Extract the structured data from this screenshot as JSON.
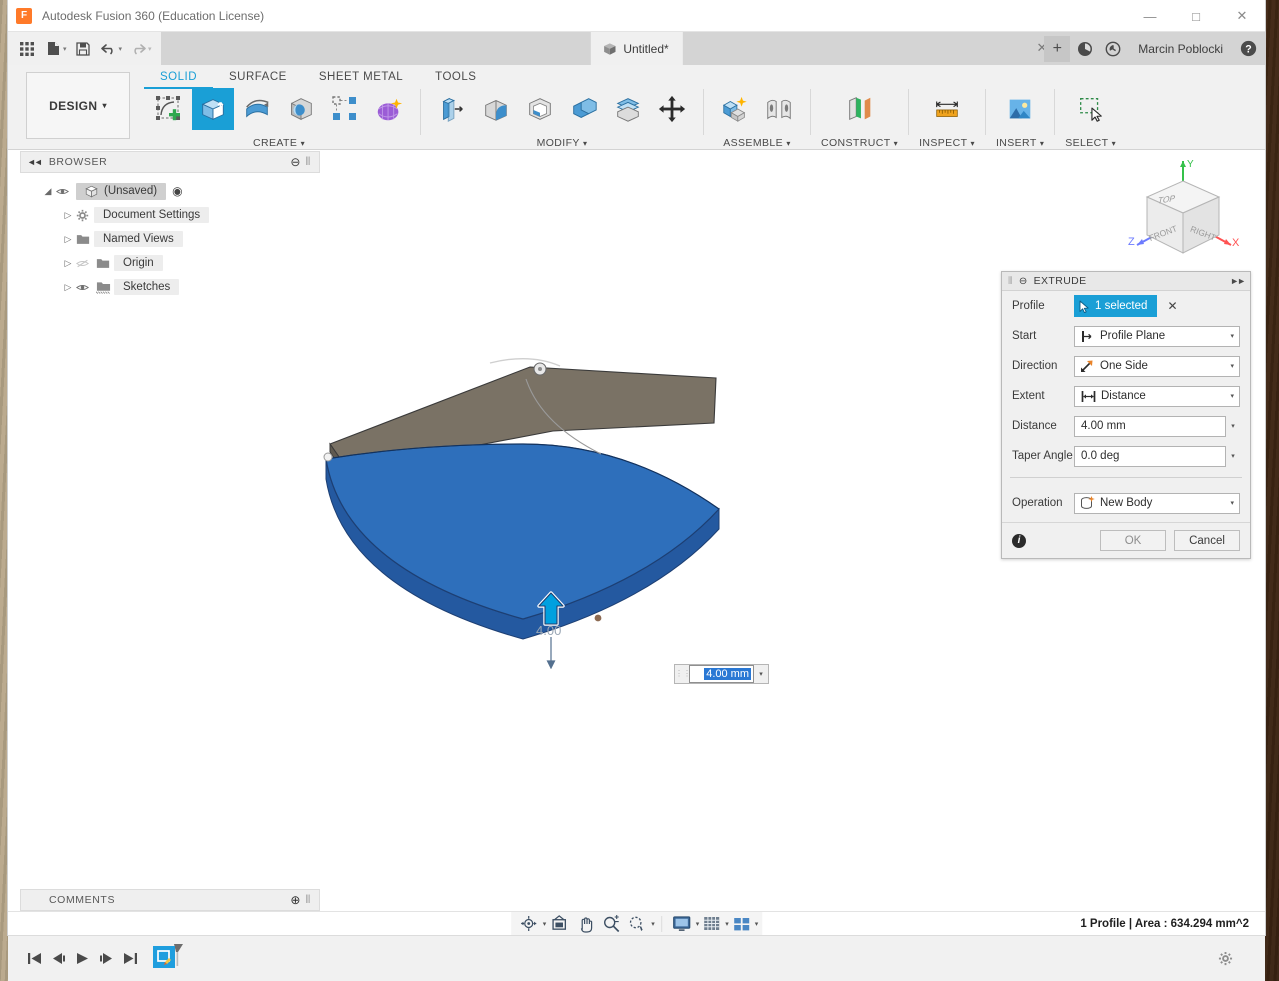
{
  "window": {
    "title": "Autodesk Fusion 360 (Education License)",
    "logo_letter": "F",
    "minimize": "—",
    "maximize": "□",
    "close": "✕"
  },
  "quick_access": {
    "grid_icon": "app-grid-icon",
    "new_icon": "new-document-icon",
    "save_icon": "save-icon",
    "undo_icon": "undo-icon",
    "redo_icon": "redo-icon",
    "caret": "▾"
  },
  "document_tab": {
    "label": "Untitled*",
    "close": "✕",
    "new_tab": "+"
  },
  "account": {
    "username": "Marcin Poblocki",
    "job_status_icon": "job-status-icon",
    "recent_icon": "recent-clock-icon",
    "help_icon": "help-icon"
  },
  "ribbon": {
    "workspace": "DESIGN",
    "workspace_caret": "▾",
    "tabs": [
      {
        "label": "SOLID",
        "active": true
      },
      {
        "label": "SURFACE",
        "active": false
      },
      {
        "label": "SHEET METAL",
        "active": false
      },
      {
        "label": "TOOLS",
        "active": false
      }
    ],
    "groups": [
      {
        "label": "CREATE",
        "caret": "▾",
        "buttons": [
          {
            "name": "create-sketch-button",
            "icon": "create-sketch-icon",
            "selected": false
          },
          {
            "name": "extrude-button",
            "icon": "extrude-icon",
            "selected": true
          },
          {
            "name": "revolve-button",
            "icon": "revolve-icon",
            "selected": false
          },
          {
            "name": "sphere-button",
            "icon": "sphere-primitive-icon",
            "selected": false
          },
          {
            "name": "pattern-button",
            "icon": "rectangular-pattern-icon",
            "selected": false
          },
          {
            "name": "create-form-button",
            "icon": "create-form-icon",
            "selected": false
          }
        ]
      },
      {
        "label": "MODIFY",
        "caret": "▾",
        "buttons": [
          {
            "name": "press-pull-button",
            "icon": "press-pull-icon",
            "selected": false
          },
          {
            "name": "fillet-button",
            "icon": "fillet-icon",
            "selected": false
          },
          {
            "name": "shell-button",
            "icon": "shell-icon",
            "selected": false
          },
          {
            "name": "combine-button",
            "icon": "combine-icon",
            "selected": false
          },
          {
            "name": "split-face-button",
            "icon": "split-face-icon",
            "selected": false
          },
          {
            "name": "move-copy-button",
            "icon": "move-copy-icon",
            "selected": false
          }
        ]
      },
      {
        "label": "ASSEMBLE",
        "caret": "▾",
        "buttons": [
          {
            "name": "new-component-button",
            "icon": "new-component-icon",
            "selected": false
          },
          {
            "name": "joint-button",
            "icon": "joint-icon",
            "selected": false
          }
        ]
      },
      {
        "label": "CONSTRUCT",
        "caret": "▾",
        "buttons": [
          {
            "name": "offset-plane-button",
            "icon": "offset-plane-icon",
            "selected": false
          }
        ]
      },
      {
        "label": "INSPECT",
        "caret": "▾",
        "buttons": [
          {
            "name": "measure-button",
            "icon": "measure-ruler-icon",
            "selected": false
          }
        ]
      },
      {
        "label": "INSERT",
        "caret": "▾",
        "buttons": [
          {
            "name": "insert-image-button",
            "icon": "insert-image-icon",
            "selected": false
          }
        ]
      },
      {
        "label": "SELECT",
        "caret": "▾",
        "buttons": [
          {
            "name": "select-tool-button",
            "icon": "select-window-cursor-icon",
            "selected": false
          }
        ]
      }
    ]
  },
  "browser": {
    "title": "BROWSER",
    "collapse_icon": "collapse-left-icon",
    "minus_icon": "minimize-panel-icon",
    "grip_icon": "panel-grip-icon",
    "tree": [
      {
        "label": "(Unsaved)",
        "caret": "◢",
        "eye": "visible",
        "icon": "component-cube-icon",
        "indent": 0,
        "root": true
      },
      {
        "label": "Document Settings",
        "caret": "▷",
        "eye": "none",
        "icon": "gear-icon",
        "indent": 1,
        "root": false
      },
      {
        "label": "Named Views",
        "caret": "▷",
        "eye": "none",
        "icon": "folder-icon",
        "indent": 1,
        "root": false
      },
      {
        "label": "Origin",
        "caret": "▷",
        "eye": "hidden",
        "icon": "folder-icon",
        "indent": 1,
        "root": false
      },
      {
        "label": "Sketches",
        "caret": "▷",
        "eye": "visible",
        "icon": "folder-icon",
        "indent": 1,
        "root": false
      }
    ]
  },
  "comments": {
    "title": "COMMENTS",
    "add_icon": "add-comment-icon",
    "grip_icon": "panel-grip-icon"
  },
  "viewcube": {
    "top_face": "TOP",
    "front_face": "FRONT",
    "right_face": "RIGHT",
    "axis_x": "X",
    "axis_y": "Y",
    "axis_z": "Z"
  },
  "canvas": {
    "manipulator_value": "4.00",
    "dimension_input_value": "4.00 mm",
    "dimension_dropdown_caret": "▾",
    "body_color": "#2e6fbb",
    "sketch_plane_color": "#7a7265",
    "arrow_color": "#00a0df"
  },
  "extrude_dialog": {
    "title": "EXTRUDE",
    "collapse_icon": "dialog-collapse-icon",
    "expand_icon": "dialog-expand-icon",
    "rows": [
      {
        "label": "Profile",
        "type": "selection",
        "value": "1 selected",
        "icon": "cursor-select-icon",
        "clear": "✕"
      },
      {
        "label": "Start",
        "type": "dropdown",
        "value": "Profile Plane",
        "icon": "profile-plane-icon",
        "caret": "▾"
      },
      {
        "label": "Direction",
        "type": "dropdown",
        "value": "One Side",
        "icon": "one-side-arrow-icon",
        "caret": "▾"
      },
      {
        "label": "Extent",
        "type": "dropdown",
        "value": "Distance",
        "icon": "distance-icon",
        "caret": "▾"
      },
      {
        "label": "Distance",
        "type": "field",
        "value": "4.00 mm",
        "caret": "▾"
      },
      {
        "label": "Taper Angle",
        "type": "field",
        "value": "0.0 deg",
        "caret": "▾"
      }
    ],
    "operation": {
      "label": "Operation",
      "value": "New Body",
      "icon": "new-body-icon",
      "caret": "▾"
    },
    "footer": {
      "info_icon": "info-icon",
      "ok_label": "OK",
      "cancel_label": "Cancel"
    }
  },
  "status_bar": {
    "text": "1 Profile | Area : 634.294 mm^2",
    "nav_buttons": [
      {
        "name": "orbit-button",
        "icon": "orbit-icon",
        "caret": "▾"
      },
      {
        "name": "look-at-button",
        "icon": "look-at-icon",
        "caret": ""
      },
      {
        "name": "pan-button",
        "icon": "pan-hand-icon",
        "caret": ""
      },
      {
        "name": "zoom-button",
        "icon": "zoom-icon",
        "caret": ""
      },
      {
        "name": "fit-button",
        "icon": "zoom-fit-icon",
        "caret": "▾"
      },
      {
        "name": "display-settings-button",
        "icon": "display-monitor-icon",
        "caret": "▾"
      },
      {
        "name": "grid-snaps-button",
        "icon": "grid-icon",
        "caret": "▾"
      },
      {
        "name": "viewports-button",
        "icon": "viewports-icon",
        "caret": "▾"
      }
    ]
  },
  "timeline": {
    "buttons": [
      {
        "name": "timeline-first-button",
        "icon": "skip-to-start-icon"
      },
      {
        "name": "timeline-prev-button",
        "icon": "step-back-icon"
      },
      {
        "name": "timeline-play-button",
        "icon": "play-icon"
      },
      {
        "name": "timeline-next-button",
        "icon": "step-forward-icon"
      },
      {
        "name": "timeline-last-button",
        "icon": "skip-to-end-icon"
      }
    ],
    "features": [
      {
        "name": "timeline-sketch-feature",
        "icon": "sketch-feature-icon"
      }
    ],
    "settings_icon": "timeline-settings-gear-icon"
  }
}
